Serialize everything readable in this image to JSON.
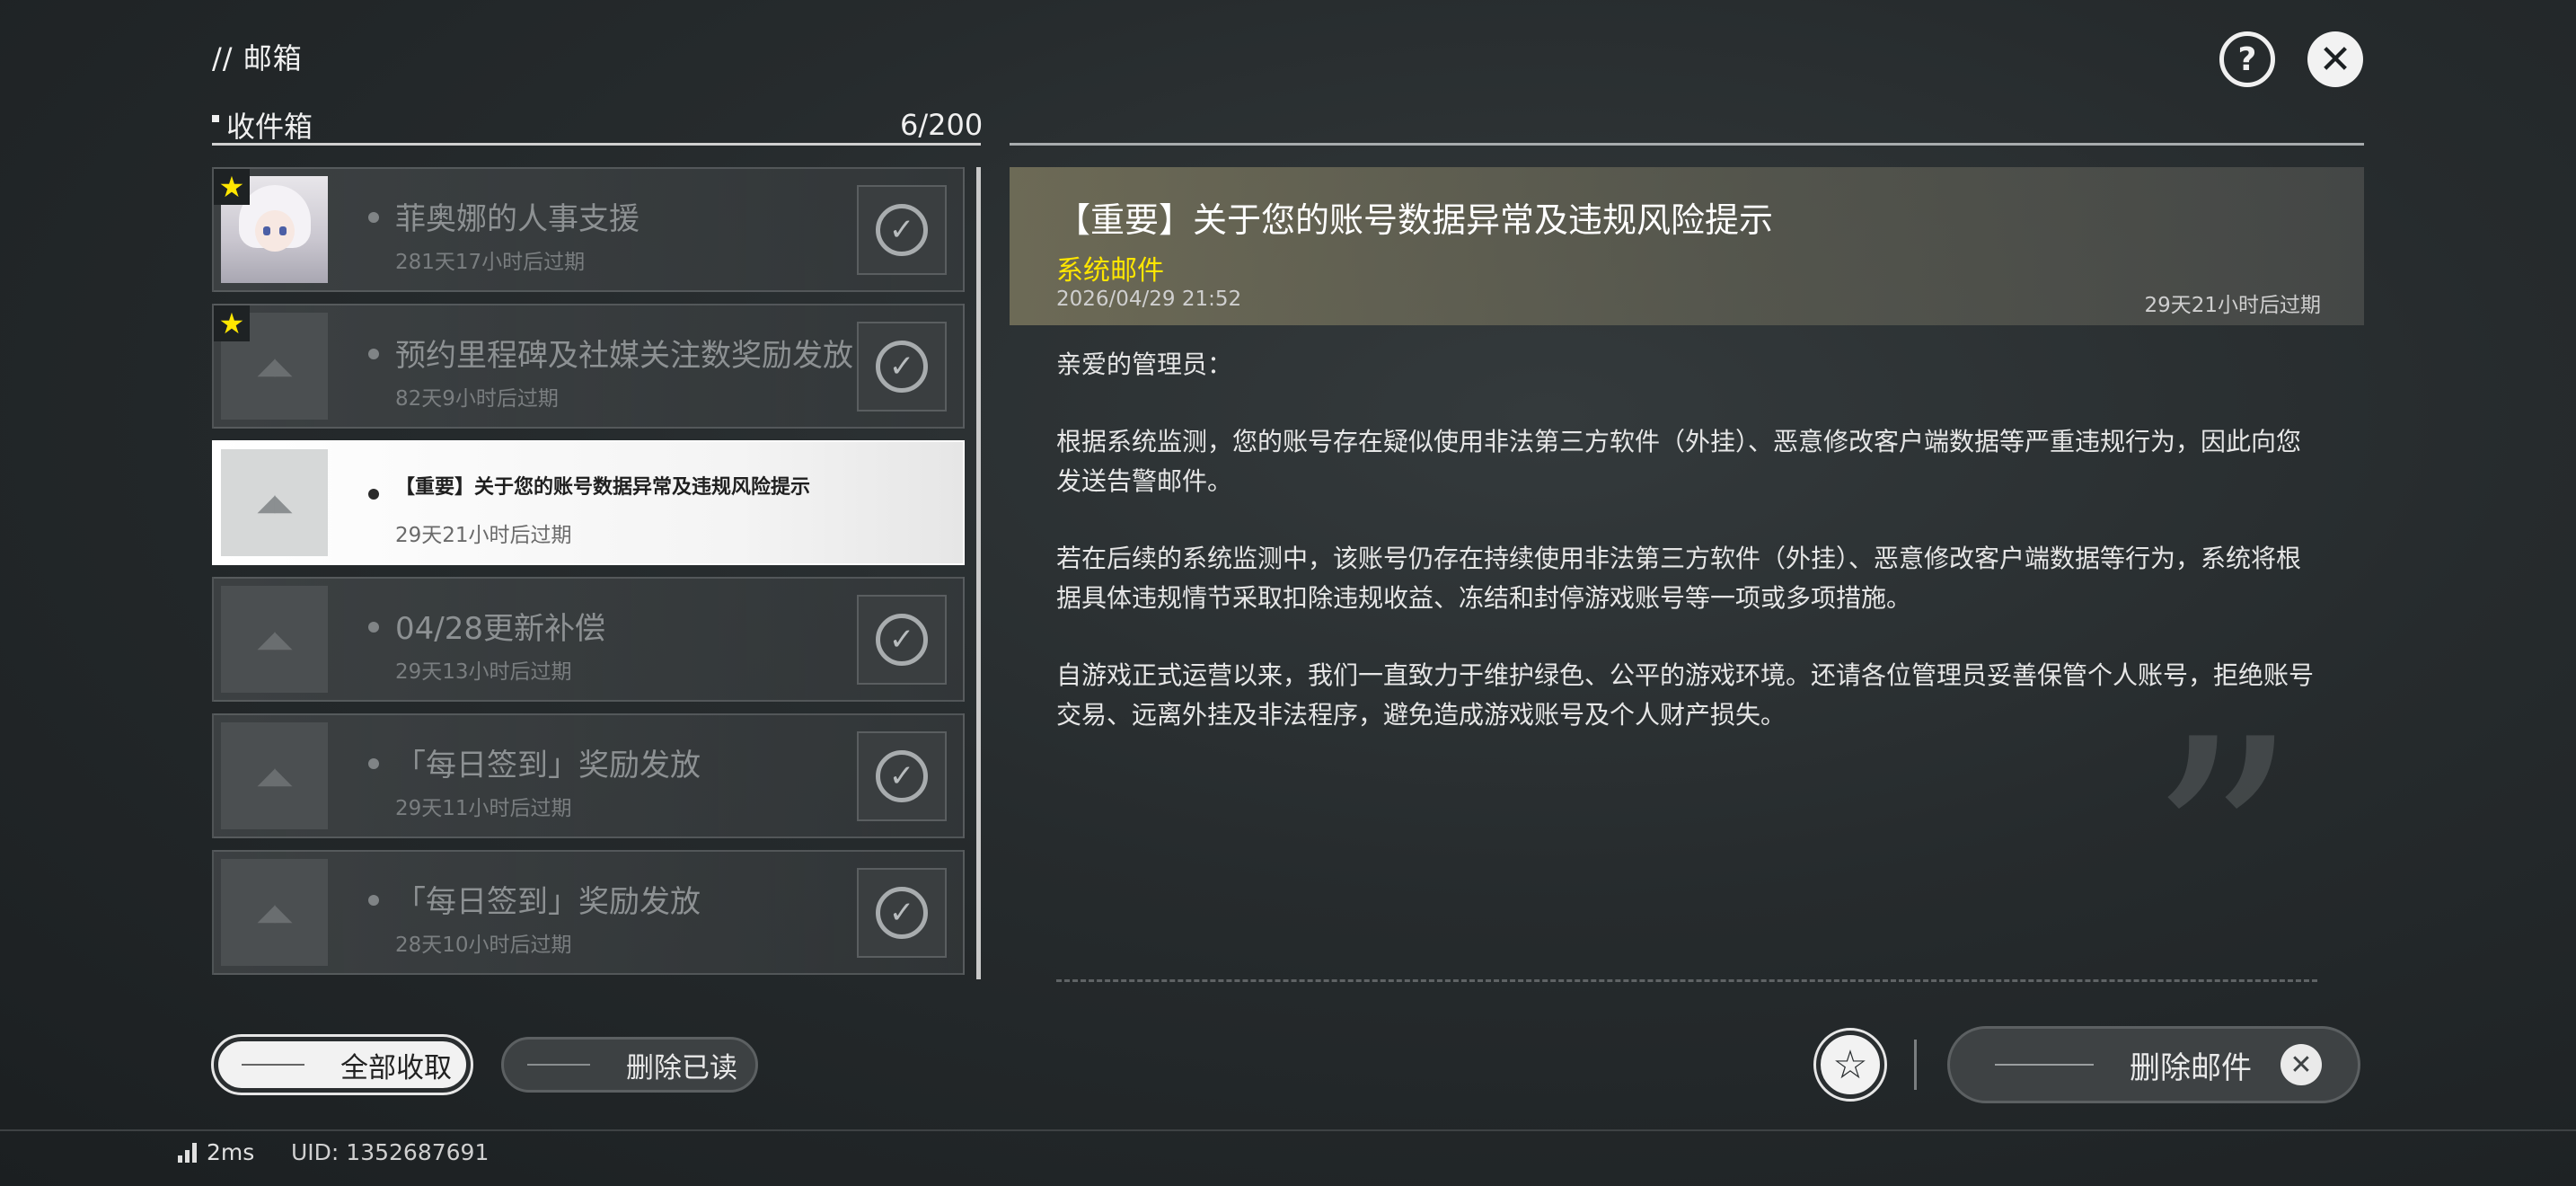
{
  "header": {
    "title": "// 邮箱",
    "help_icon": "help-icon",
    "close_icon": "close-icon"
  },
  "inbox": {
    "label": "收件箱",
    "count": "6/200"
  },
  "mails": [
    {
      "title": "菲奥娜的人事支援",
      "expiry": "281天17小时后过期",
      "starred": true,
      "thumb": "character-avatar",
      "read": true
    },
    {
      "title": "预约里程碑及社媒关注数奖励发放",
      "expiry": "82天9小时后过期",
      "starred": true,
      "thumb": "logo",
      "read": true
    },
    {
      "title": "【重要】关于您的账号数据异常及违规风险提示",
      "expiry": "29天21小时后过期",
      "starred": false,
      "thumb": "logo",
      "read": false,
      "selected": true
    },
    {
      "title": "04/28更新补偿",
      "expiry": "29天13小时后过期",
      "starred": false,
      "thumb": "logo",
      "read": true
    },
    {
      "title": "「每日签到」奖励发放",
      "expiry": "29天11小时后过期",
      "starred": false,
      "thumb": "logo",
      "read": true
    },
    {
      "title": "「每日签到」奖励发放",
      "expiry": "28天10小时后过期",
      "starred": false,
      "thumb": "logo",
      "read": true
    }
  ],
  "detail": {
    "title": "【重要】关于您的账号数据异常及违规风险提示",
    "sender": "系统邮件",
    "date": "2026/04/29 21:52",
    "expiry": "29天21小时后过期",
    "body": [
      "亲爱的管理员：",
      "根据系统监测，您的账号存在疑似使用非法第三方软件（外挂）、恶意修改客户端数据等严重违规行为，因此向您发送告警邮件。",
      "若在后续的系统监测中，该账号仍存在持续使用非法第三方软件（外挂）、恶意修改客户端数据等行为，系统将根据具体违规情节采取扣除违规收益、冻结和封停游戏账号等一项或多项措施。",
      "自游戏正式运营以来，我们一直致力于维护绿色、公平的游戏环境。还请各位管理员妥善保管个人账号，拒绝账号交易、远离外挂及非法程序，避免造成游戏账号及个人财产损失。"
    ]
  },
  "actions": {
    "collect_all": "全部收取",
    "delete_read": "删除已读",
    "delete_mail": "删除邮件"
  },
  "footer": {
    "ping": "2ms",
    "uid": "UID: 1352687691"
  },
  "colors": {
    "accent_yellow": "#ffe600",
    "selected_bg": "#ffffff",
    "panel_bg": "#3e4244"
  }
}
